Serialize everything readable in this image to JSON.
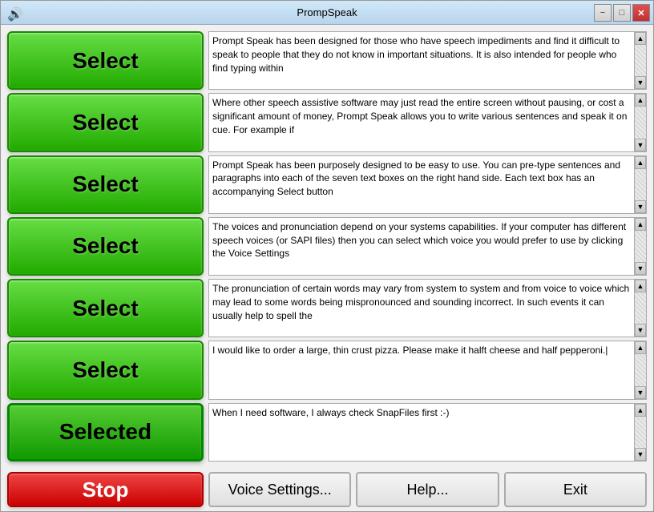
{
  "window": {
    "title": "PrompSpeak",
    "icon": "🔊"
  },
  "titlebar": {
    "minimize_label": "−",
    "maximize_label": "□",
    "close_label": "✕"
  },
  "rows": [
    {
      "id": "row1",
      "button_label": "Select",
      "button_type": "select",
      "text": "Prompt Speak has been designed for those who have speech impediments and find it difficult to speak to people that they do not know in important situations. It is also intended for people who find typing within"
    },
    {
      "id": "row2",
      "button_label": "Select",
      "button_type": "select",
      "text": "Where other speech assistive software may just read the entire screen without pausing, or cost a significant amount of money, Prompt Speak allows you to write various sentences and speak it on cue. For example if"
    },
    {
      "id": "row3",
      "button_label": "Select",
      "button_type": "select",
      "text": "Prompt Speak has been purposely designed to be easy to use. You can pre-type sentences and paragraphs into each of the seven text boxes on the right hand side. Each text box has an accompanying Select button"
    },
    {
      "id": "row4",
      "button_label": "Select",
      "button_type": "select",
      "text": "The voices and pronunciation depend on your systems capabilities. If your computer has different speech voices (or SAPI files) then you can select which voice you would prefer to use by clicking the Voice Settings"
    },
    {
      "id": "row5",
      "button_label": "Select",
      "button_type": "select",
      "text": "The pronunciation of certain words may vary from system to system and from voice to voice which may lead to some words being mispronounced and sounding incorrect. In such events it can usually help to spell the"
    },
    {
      "id": "row6",
      "button_label": "Select",
      "button_type": "select",
      "text": "I would like to order a large, thin crust pizza. Please make it halft cheese and half pepperoni.|"
    },
    {
      "id": "row7",
      "button_label": "Selected",
      "button_type": "selected",
      "text": "When I need software, I always check SnapFiles first :-)"
    }
  ],
  "bottom": {
    "stop_label": "Stop",
    "voice_settings_label": "Voice Settings...",
    "help_label": "Help...",
    "exit_label": "Exit"
  }
}
